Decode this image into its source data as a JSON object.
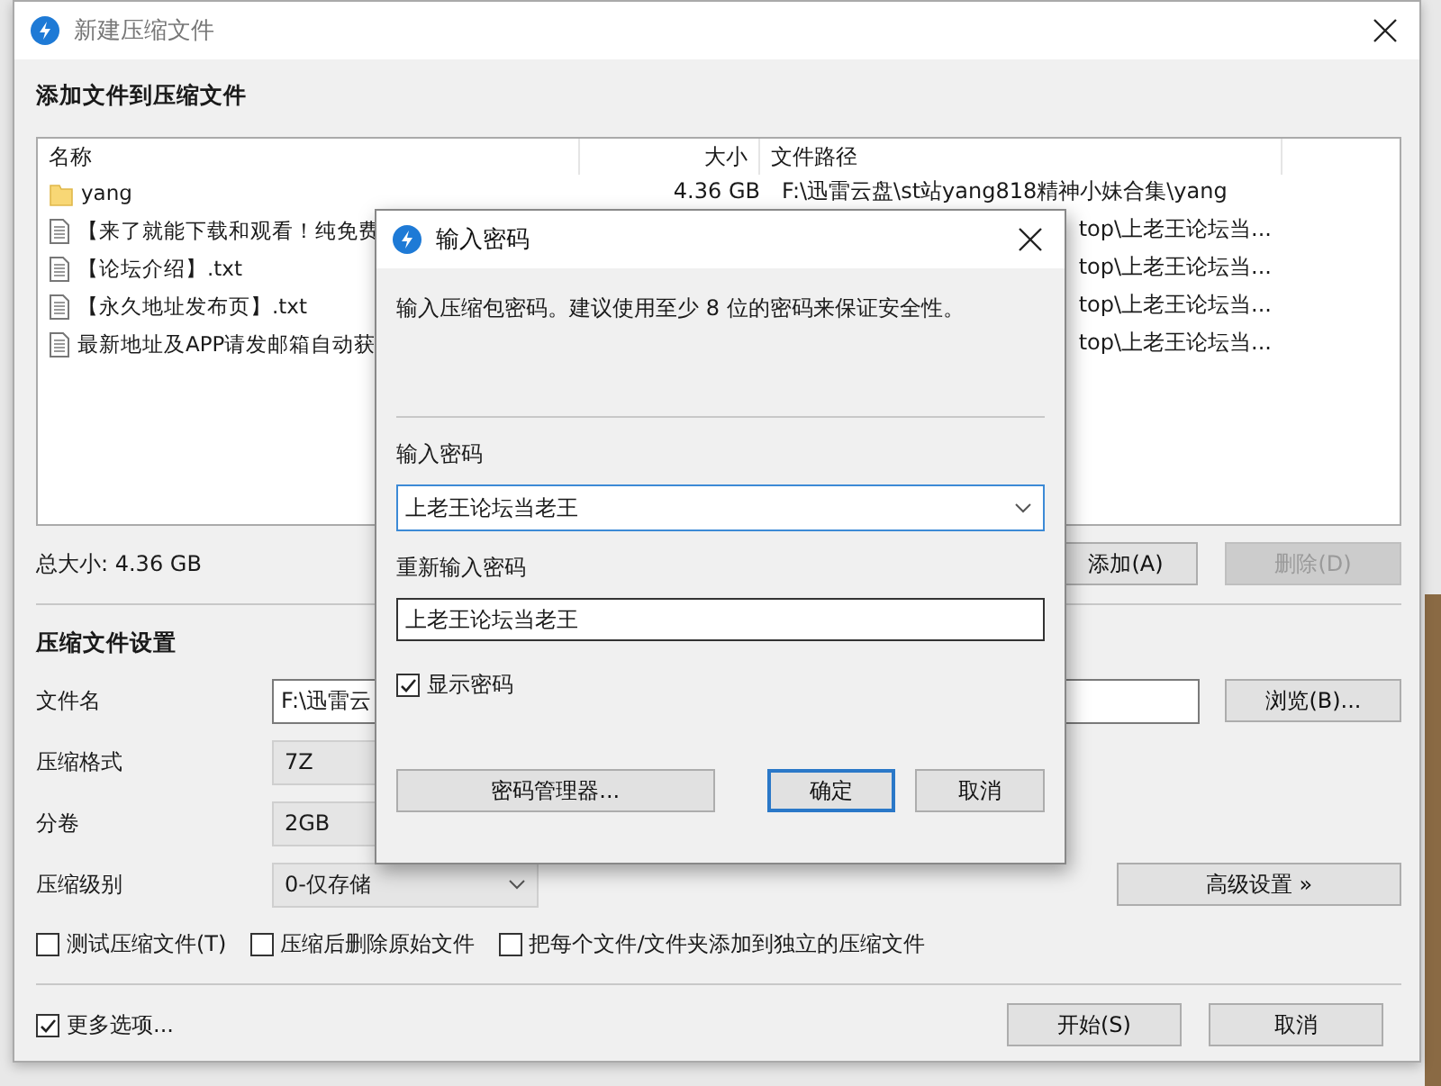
{
  "window": {
    "title": "新建压缩文件"
  },
  "files": {
    "heading": "添加文件到压缩文件",
    "columns": [
      "名称",
      "大小",
      "文件路径"
    ],
    "rows": [
      {
        "kind": "folder",
        "name": "yang",
        "size": "4.36 GB",
        "path": "F:\\迅雷云盘\\st站yang818精神小妹合集\\yang"
      },
      {
        "kind": "file",
        "name": "【来了就能下载和观看！纯免费",
        "path": "top\\上老王论坛当..."
      },
      {
        "kind": "file",
        "name": "【论坛介绍】.txt",
        "path": "top\\上老王论坛当..."
      },
      {
        "kind": "file",
        "name": "【永久地址发布页】.txt",
        "path": "top\\上老王论坛当..."
      },
      {
        "kind": "file",
        "name": "最新地址及APP请发邮箱自动获",
        "path": "top\\上老王论坛当..."
      }
    ]
  },
  "total_size": "总大小: 4.36 GB",
  "file_buttons": [
    {
      "label": "添加(A)",
      "disabled": false
    },
    {
      "label": "删除(D)",
      "disabled": true
    }
  ],
  "settings": {
    "heading": "压缩文件设置",
    "fields": [
      {
        "kind": "text",
        "label": "文件名",
        "value": "F:\\迅雷云",
        "button": "浏览(B)..."
      },
      {
        "kind": "select",
        "label": "压缩格式",
        "value": "7Z"
      },
      {
        "kind": "select",
        "label": "分卷",
        "value": "2GB"
      },
      {
        "kind": "dropdown",
        "label": "压缩级别",
        "value": "0-仅存储",
        "button": "高级设置 »"
      }
    ],
    "options": [
      {
        "label": "测试压缩文件(T)",
        "checked": false
      },
      {
        "label": "压缩后删除原始文件",
        "checked": false
      },
      {
        "label": "把每个文件/文件夹添加到独立的压缩文件",
        "checked": false
      }
    ]
  },
  "more_options": {
    "label": "更多选项...",
    "checked": true
  },
  "buttons": [
    "开始(S)",
    "取消"
  ],
  "password_dialog": {
    "title": "输入密码",
    "description": "输入压缩包密码。建议使用至少 8 位的密码来保证安全性。",
    "password_label": "输入密码",
    "password": "上老王论坛当老王",
    "confirm_label": "重新输入密码",
    "confirm": "上老王论坛当老王",
    "show_password": {
      "label": "显示密码",
      "checked": true
    },
    "buttons": [
      {
        "label": "密码管理器...",
        "kind": "wide",
        "default": false
      },
      {
        "label": "确定",
        "kind": "normal",
        "default": true
      },
      {
        "label": "取消",
        "kind": "normal",
        "default": false
      }
    ]
  }
}
